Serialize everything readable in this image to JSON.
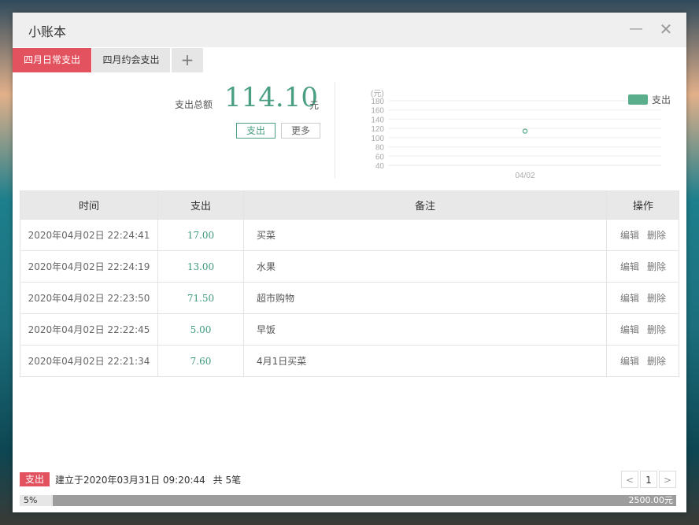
{
  "window": {
    "title": "小账本"
  },
  "tabs": [
    {
      "label": "四月日常支出",
      "active": true
    },
    {
      "label": "四月约会支出",
      "active": false
    }
  ],
  "tab_add_icon": "+",
  "summary": {
    "label": "支出总额",
    "value": "114.10",
    "unit": "元",
    "btn_expense": "支出",
    "btn_more": "更多"
  },
  "chart_data": {
    "type": "scatter",
    "ylabel": "(元)",
    "yticks": [
      180,
      160,
      140,
      120,
      100,
      80,
      60,
      40
    ],
    "ylim": [
      40,
      180
    ],
    "categories": [
      "04/02"
    ],
    "series": [
      {
        "name": "支出",
        "values": [
          114.1
        ],
        "color": "#5aae8c"
      }
    ],
    "legend": "top-right",
    "grid": true
  },
  "table": {
    "headers": {
      "time": "时间",
      "amount": "支出",
      "note": "备注",
      "ops": "操作"
    },
    "rows": [
      {
        "time": "2020年04月02日 22:24:41",
        "amount": "17.00",
        "note": "买菜",
        "edit": "编辑",
        "del": "删除"
      },
      {
        "time": "2020年04月02日 22:24:19",
        "amount": "13.00",
        "note": "水果",
        "edit": "编辑",
        "del": "删除"
      },
      {
        "time": "2020年04月02日 22:23:50",
        "amount": "71.50",
        "note": "超市购物",
        "edit": "编辑",
        "del": "删除"
      },
      {
        "time": "2020年04月02日 22:22:45",
        "amount": "5.00",
        "note": "早饭",
        "edit": "编辑",
        "del": "删除"
      },
      {
        "time": "2020年04月02日 22:21:34",
        "amount": "7.60",
        "note": "4月1日买菜",
        "edit": "编辑",
        "del": "删除"
      }
    ]
  },
  "footer": {
    "badge": "支出",
    "created": "建立于2020年03月31日 09:20:44",
    "count": "共 5笔",
    "page": "1",
    "prev": "<",
    "next": ">"
  },
  "budget": {
    "percent_label": "5%",
    "fraction": 0.05,
    "total": "2500.00元"
  },
  "colors": {
    "accent_red": "#e2525f",
    "accent_green": "#4a9f82"
  }
}
